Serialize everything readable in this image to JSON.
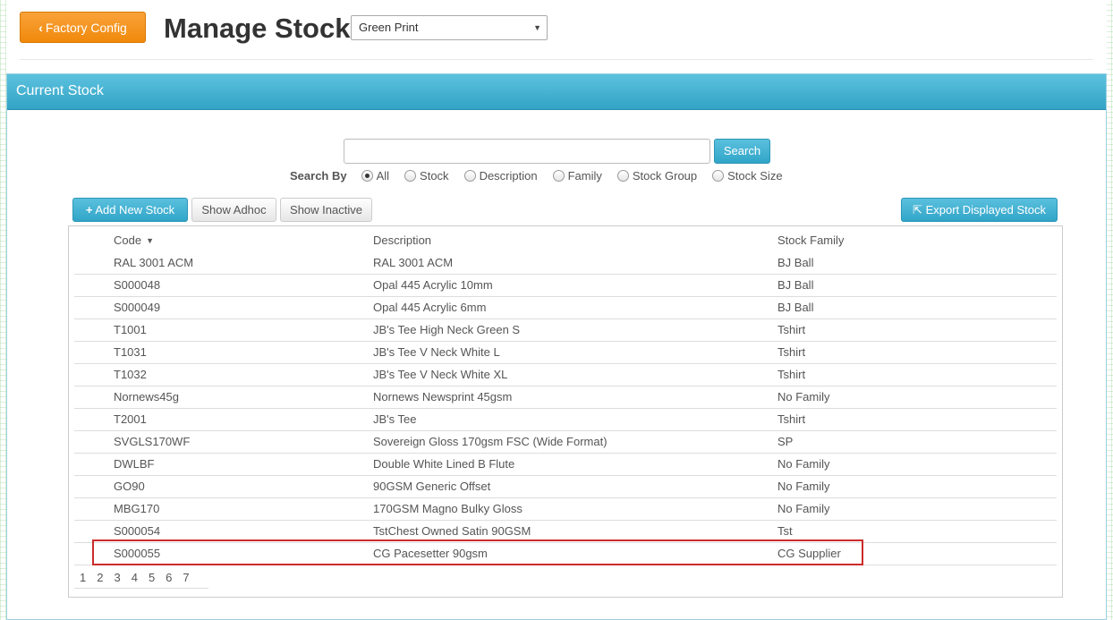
{
  "header": {
    "back_label": "Factory Config",
    "title": "Manage Stock",
    "company_select": "Green Print"
  },
  "panel": {
    "title": "Current Stock",
    "search": {
      "value": "",
      "button_label": "Search",
      "by_label": "Search By",
      "options": [
        "All",
        "Stock",
        "Description",
        "Family",
        "Stock Group",
        "Stock Size"
      ],
      "selected": "All"
    },
    "toolbar": {
      "add_label": "Add New Stock",
      "adhoc_label": "Show Adhoc",
      "inactive_label": "Show Inactive",
      "export_label": "Export Displayed Stock"
    },
    "table": {
      "columns": [
        "Code",
        "Description",
        "Stock Family"
      ],
      "rows": [
        [
          "RAL 3001 ACM",
          "RAL 3001 ACM",
          "BJ Ball"
        ],
        [
          "S000048",
          "Opal 445 Acrylic 10mm",
          "BJ Ball"
        ],
        [
          "S000049",
          "Opal 445 Acrylic 6mm",
          "BJ Ball"
        ],
        [
          "T1001",
          "JB's Tee High Neck Green S",
          "Tshirt"
        ],
        [
          "T1031",
          "JB's Tee V Neck White L",
          "Tshirt"
        ],
        [
          "T1032",
          "JB's Tee V Neck White XL",
          "Tshirt"
        ],
        [
          "Nornews45g",
          "Nornews Newsprint 45gsm",
          "No Family"
        ],
        [
          "T2001",
          "JB's Tee",
          "Tshirt"
        ],
        [
          "SVGLS170WF",
          "Sovereign Gloss 170gsm FSC (Wide Format)",
          "SP"
        ],
        [
          "DWLBF",
          "Double White Lined B Flute",
          "No Family"
        ],
        [
          "GO90",
          "90GSM Generic Offset",
          "No Family"
        ],
        [
          "MBG170",
          "170GSM Magno Bulky Gloss",
          "No Family"
        ],
        [
          "S000054",
          "TstChest Owned Satin 90GSM",
          "Tst"
        ],
        [
          "S000055",
          "CG Pacesetter 90gsm",
          "CG Supplier"
        ]
      ]
    },
    "pager": [
      "1",
      "2",
      "3",
      "4",
      "5",
      "6",
      "7"
    ]
  },
  "colors": {
    "accent_orange": "#f0890b",
    "accent_blue": "#31a5c8",
    "highlight_red": "#cc2b2b"
  }
}
